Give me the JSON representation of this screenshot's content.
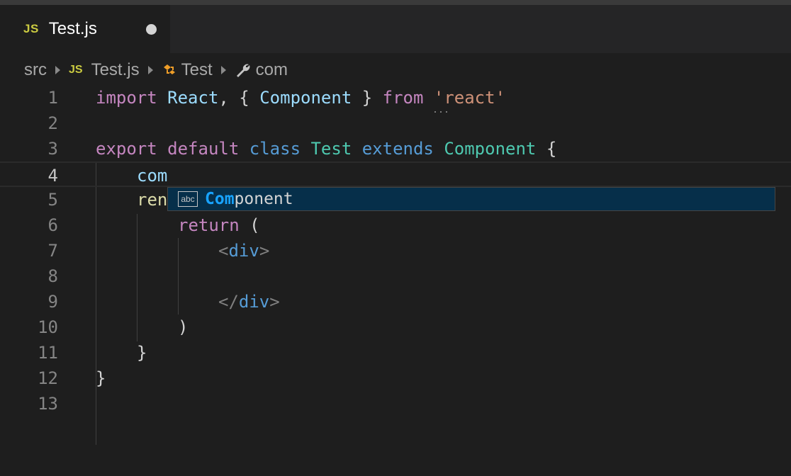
{
  "tab": {
    "lang_badge": "JS",
    "filename": "Test.js"
  },
  "breadcrumb": {
    "folder": "src",
    "file_badge": "JS",
    "file": "Test.js",
    "class": "Test",
    "symbol": "com"
  },
  "lines": [
    {
      "n": "1"
    },
    {
      "n": "2"
    },
    {
      "n": "3"
    },
    {
      "n": "4"
    },
    {
      "n": "5"
    },
    {
      "n": "6"
    },
    {
      "n": "7"
    },
    {
      "n": "8"
    },
    {
      "n": "9"
    },
    {
      "n": "10"
    },
    {
      "n": "11"
    },
    {
      "n": "12"
    },
    {
      "n": "13"
    }
  ],
  "code": {
    "l1": {
      "import": "import",
      "react": "React",
      "comma": ", {",
      "component": "Component",
      "close": "}",
      "from": "from",
      "str": "'react'"
    },
    "l3": {
      "export": "export",
      "default": "default",
      "class": "class",
      "name": "Test",
      "extends": "extends",
      "parent": "Component",
      "brace": "{"
    },
    "l4": {
      "typed": "com"
    },
    "l5": {
      "partial": "ren"
    },
    "l6": {
      "ret": "return",
      "paren": "("
    },
    "l7": {
      "open": "<",
      "tag": "div",
      "close": ">"
    },
    "l9": {
      "open": "</",
      "tag": "div",
      "close": ">"
    },
    "l10": {
      "paren": ")"
    },
    "l11": {
      "brace": "}"
    },
    "l12": {
      "brace": "}"
    }
  },
  "suggest": {
    "icon_text": "abc",
    "match": "Com",
    "rest": "ponent"
  },
  "colors": {
    "background": "#1e1e1e",
    "keyword": "#c586c0",
    "type": "#4ec9b0",
    "string": "#ce9178",
    "highlight": "#18a3ff"
  }
}
